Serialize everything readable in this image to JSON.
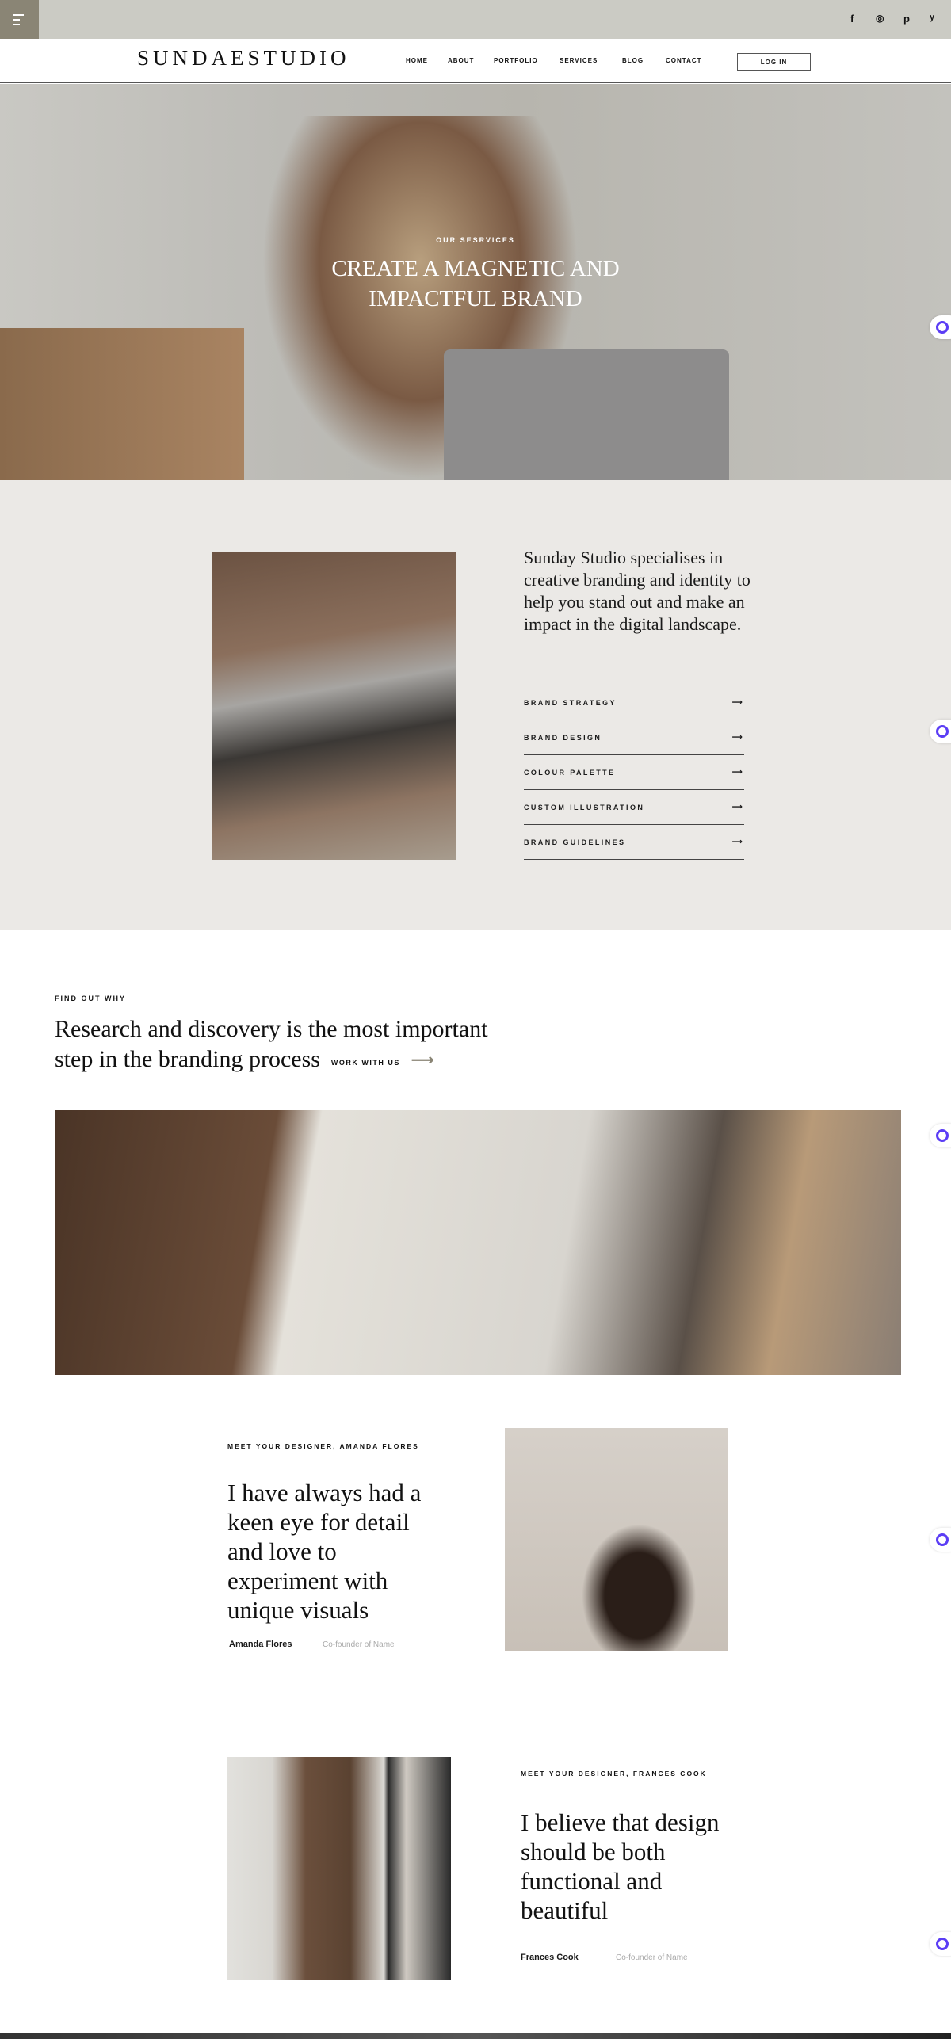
{
  "topbar": {
    "social": [
      {
        "icon": "facebook-icon",
        "glyph": "f"
      },
      {
        "icon": "instagram-icon",
        "glyph": "◎"
      },
      {
        "icon": "pinterest-icon",
        "glyph": "𝓅"
      },
      {
        "icon": "twitter-icon",
        "glyph": "🐦"
      }
    ]
  },
  "nav": {
    "logo": "SUNDAESTUDIO",
    "items": [
      "HOME",
      "ABOUT",
      "PORTFOLIO",
      "SERVICES",
      "BLOG",
      "CONTACT"
    ],
    "login": "LOG IN"
  },
  "hero": {
    "eyebrow": "OUR SESRVICES",
    "title_line1": "CREATE A MAGNETIC AND",
    "title_line2": "IMPACTFUL BRAND"
  },
  "services": {
    "intro": "Sunday Studio specialises in creative branding and identity to help you stand out and make an impact in the digital landscape.",
    "items": [
      "BRAND STRATEGY",
      "BRAND DESIGN",
      "COLOUR PALETTE",
      "CUSTOM ILLUSTRATION",
      "BRAND GUIDELINES"
    ],
    "arrow": "⟶"
  },
  "why": {
    "eyebrow": "FIND OUT WHY",
    "heading_line1": "Research and discovery is the most important",
    "heading_line2": "step in the branding process",
    "cta": "WORK WITH US",
    "arrow": "⟶"
  },
  "designers": [
    {
      "eyebrow": "MEET YOUR DESIGNER, AMANDA FLORES",
      "quote": "I have always had a keen eye for detail and love to experiment with unique visuals",
      "name": "Amanda Flores",
      "role": "Co-founder of Name"
    },
    {
      "eyebrow": "MEET YOUR DESIGNER, FRANCES COOK",
      "quote": "I believe that design should be both functional and beautiful",
      "name": "Frances Cook",
      "role": "Co-founder of Name"
    }
  ],
  "colors": {
    "topbar": "#cbcbc4",
    "menu": "#8a8575",
    "services_bg": "#ebe9e6",
    "chat_accent": "#5b3df5"
  }
}
